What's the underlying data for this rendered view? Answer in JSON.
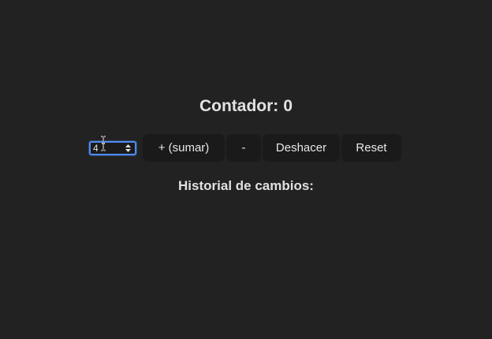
{
  "counter": {
    "label": "Contador:",
    "value": "0"
  },
  "controls": {
    "step_value": "4",
    "add_label": "+ (sumar)",
    "subtract_label": "-",
    "undo_label": "Deshacer",
    "reset_label": "Reset"
  },
  "history": {
    "title": "Historial de cambios:",
    "items": []
  },
  "colors": {
    "background": "#222222",
    "button_bg": "#1a1a1a",
    "focus_ring": "#4d8bf0",
    "text": "#e4e4e4"
  }
}
